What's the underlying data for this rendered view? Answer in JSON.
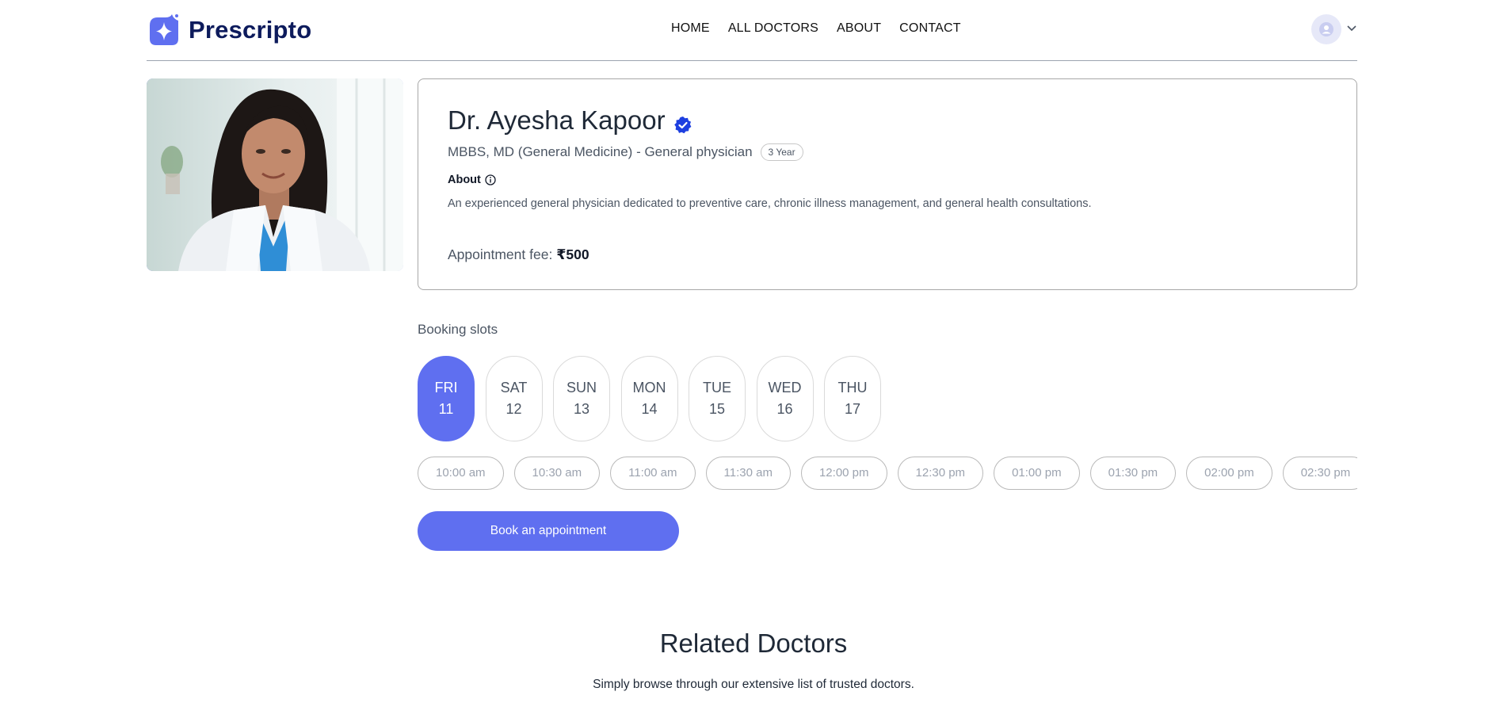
{
  "brand": {
    "name": "Prescripto",
    "color": "#5f6ff0",
    "logo_icon": "sparkle-icon"
  },
  "nav": {
    "items": [
      {
        "label": "HOME"
      },
      {
        "label": "ALL DOCTORS"
      },
      {
        "label": "ABOUT"
      },
      {
        "label": "CONTACT"
      }
    ],
    "user_icon": "user-avatar-icon",
    "menu_icon": "chevron-down-icon"
  },
  "doctor": {
    "name": "Dr. Ayesha Kapoor",
    "verified_icon": "verified-badge-icon",
    "degree": "MBBS, MD (General Medicine) - General physician",
    "experience": "3 Year",
    "about_label": "About",
    "about_text": "An experienced general physician dedicated to preventive care, chronic illness management, and general health consultations.",
    "fee_label": "Appointment fee:",
    "fee_value": "₹500"
  },
  "booking": {
    "title": "Booking slots",
    "days": [
      {
        "day": "FRI",
        "date": "11",
        "selected": true
      },
      {
        "day": "SAT",
        "date": "12",
        "selected": false
      },
      {
        "day": "SUN",
        "date": "13",
        "selected": false
      },
      {
        "day": "MON",
        "date": "14",
        "selected": false
      },
      {
        "day": "TUE",
        "date": "15",
        "selected": false
      },
      {
        "day": "WED",
        "date": "16",
        "selected": false
      },
      {
        "day": "THU",
        "date": "17",
        "selected": false
      }
    ],
    "slots": [
      "10:00 am",
      "10:30 am",
      "11:00 am",
      "11:30 am",
      "12:00 pm",
      "12:30 pm",
      "01:00 pm",
      "01:30 pm",
      "02:00 pm",
      "02:30 pm"
    ],
    "button_label": "Book an appointment"
  },
  "related": {
    "title": "Related Doctors",
    "subtitle": "Simply browse through our extensive list of trusted doctors."
  }
}
